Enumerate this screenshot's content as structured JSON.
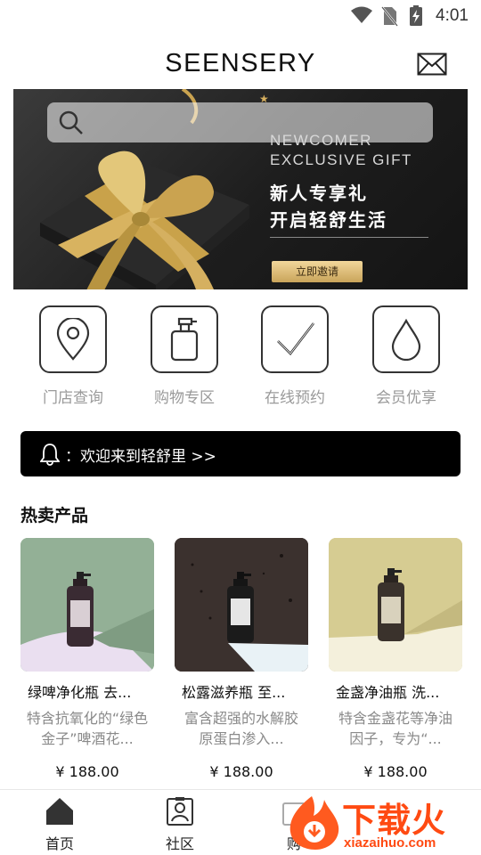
{
  "status_bar": {
    "time": "4:01"
  },
  "header": {
    "brand": "SEENSERY"
  },
  "banner": {
    "en_line1": "NEWCOMER",
    "en_line2": "EXCLUSIVE GIFT",
    "cn_line1": "新人专享礼",
    "cn_line2": "开启轻舒生活",
    "invite_button": "立即邀请"
  },
  "quick_nav": [
    {
      "label": "门店查询",
      "icon": "location-pin-icon"
    },
    {
      "label": "购物专区",
      "icon": "bottle-icon"
    },
    {
      "label": "在线预约",
      "icon": "check-icon"
    },
    {
      "label": "会员优享",
      "icon": "drop-icon"
    }
  ],
  "notice": {
    "text": "：欢迎来到轻舒里 >>"
  },
  "hot_products": {
    "title": "热卖产品",
    "items": [
      {
        "name": "绿啤净化瓶 去...",
        "desc": "特含抗氧化的“绿色金子”啤酒花...",
        "price": "¥ 188.00"
      },
      {
        "name": "松露滋养瓶 至...",
        "desc": "富含超强的水解胶原蛋白渗入...",
        "price": "¥ 188.00"
      },
      {
        "name": "金盏净油瓶 洗...",
        "desc": "特含金盏花等净油因子，专为“...",
        "price": "¥ 188.00"
      }
    ]
  },
  "bottom_nav": [
    {
      "label": "首页"
    },
    {
      "label": "社区"
    },
    {
      "label": "购"
    }
  ],
  "watermark": {
    "text": "下载火",
    "url": "xiazaihuo.com"
  }
}
